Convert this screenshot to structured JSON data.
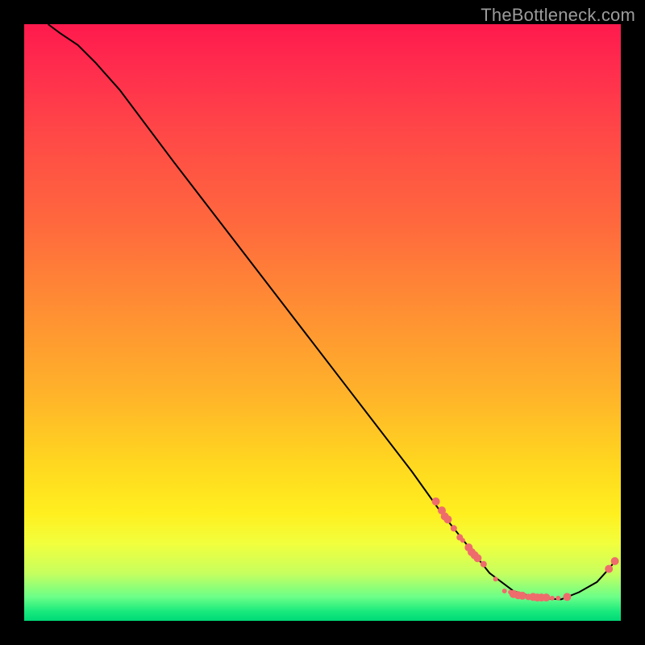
{
  "watermark": "TheBottleneck.com",
  "colors": {
    "background": "#000000",
    "curve": "#000000",
    "point": "#ef6c6c"
  },
  "chart_data": {
    "type": "line",
    "title": "",
    "xlabel": "",
    "ylabel": "",
    "xlim": [
      0,
      100
    ],
    "ylim": [
      0,
      100
    ],
    "grid": false,
    "legend": false,
    "curve": [
      {
        "x": 4,
        "y": 100
      },
      {
        "x": 6,
        "y": 98.5
      },
      {
        "x": 9,
        "y": 96.5
      },
      {
        "x": 12,
        "y": 93.5
      },
      {
        "x": 16,
        "y": 89
      },
      {
        "x": 25,
        "y": 77
      },
      {
        "x": 35,
        "y": 64
      },
      {
        "x": 45,
        "y": 51
      },
      {
        "x": 55,
        "y": 38
      },
      {
        "x": 65,
        "y": 25
      },
      {
        "x": 70,
        "y": 18
      },
      {
        "x": 74,
        "y": 13
      },
      {
        "x": 78,
        "y": 8
      },
      {
        "x": 82,
        "y": 5
      },
      {
        "x": 86,
        "y": 3.8
      },
      {
        "x": 90,
        "y": 3.6
      },
      {
        "x": 93,
        "y": 4.8
      },
      {
        "x": 96,
        "y": 6.5
      },
      {
        "x": 98,
        "y": 8.7
      },
      {
        "x": 99,
        "y": 10
      }
    ],
    "points": [
      {
        "x": 69,
        "y": 20,
        "r": 5
      },
      {
        "x": 70,
        "y": 18.5,
        "r": 5
      },
      {
        "x": 70.5,
        "y": 17.5,
        "r": 5
      },
      {
        "x": 71,
        "y": 17,
        "r": 5
      },
      {
        "x": 72,
        "y": 15.5,
        "r": 4
      },
      {
        "x": 73,
        "y": 14,
        "r": 4
      },
      {
        "x": 73.5,
        "y": 13.5,
        "r": 3
      },
      {
        "x": 74.5,
        "y": 12.3,
        "r": 5
      },
      {
        "x": 75,
        "y": 11.5,
        "r": 5
      },
      {
        "x": 75.5,
        "y": 11,
        "r": 5
      },
      {
        "x": 76,
        "y": 10.5,
        "r": 5
      },
      {
        "x": 77,
        "y": 9.5,
        "r": 4
      },
      {
        "x": 79,
        "y": 7,
        "r": 3
      },
      {
        "x": 80.5,
        "y": 5,
        "r": 3
      },
      {
        "x": 81.5,
        "y": 4.8,
        "r": 3
      },
      {
        "x": 82,
        "y": 4.5,
        "r": 5
      },
      {
        "x": 82.8,
        "y": 4.3,
        "r": 5
      },
      {
        "x": 83.5,
        "y": 4.2,
        "r": 5
      },
      {
        "x": 84.5,
        "y": 4.0,
        "r": 4
      },
      {
        "x": 85.3,
        "y": 4.0,
        "r": 5
      },
      {
        "x": 86,
        "y": 3.9,
        "r": 5
      },
      {
        "x": 86.7,
        "y": 3.9,
        "r": 5
      },
      {
        "x": 87.5,
        "y": 3.9,
        "r": 5
      },
      {
        "x": 88.5,
        "y": 3.8,
        "r": 3
      },
      {
        "x": 89.5,
        "y": 3.8,
        "r": 3
      },
      {
        "x": 91,
        "y": 4.0,
        "r": 5
      },
      {
        "x": 98,
        "y": 8.7,
        "r": 5
      },
      {
        "x": 99,
        "y": 10,
        "r": 5
      }
    ]
  }
}
